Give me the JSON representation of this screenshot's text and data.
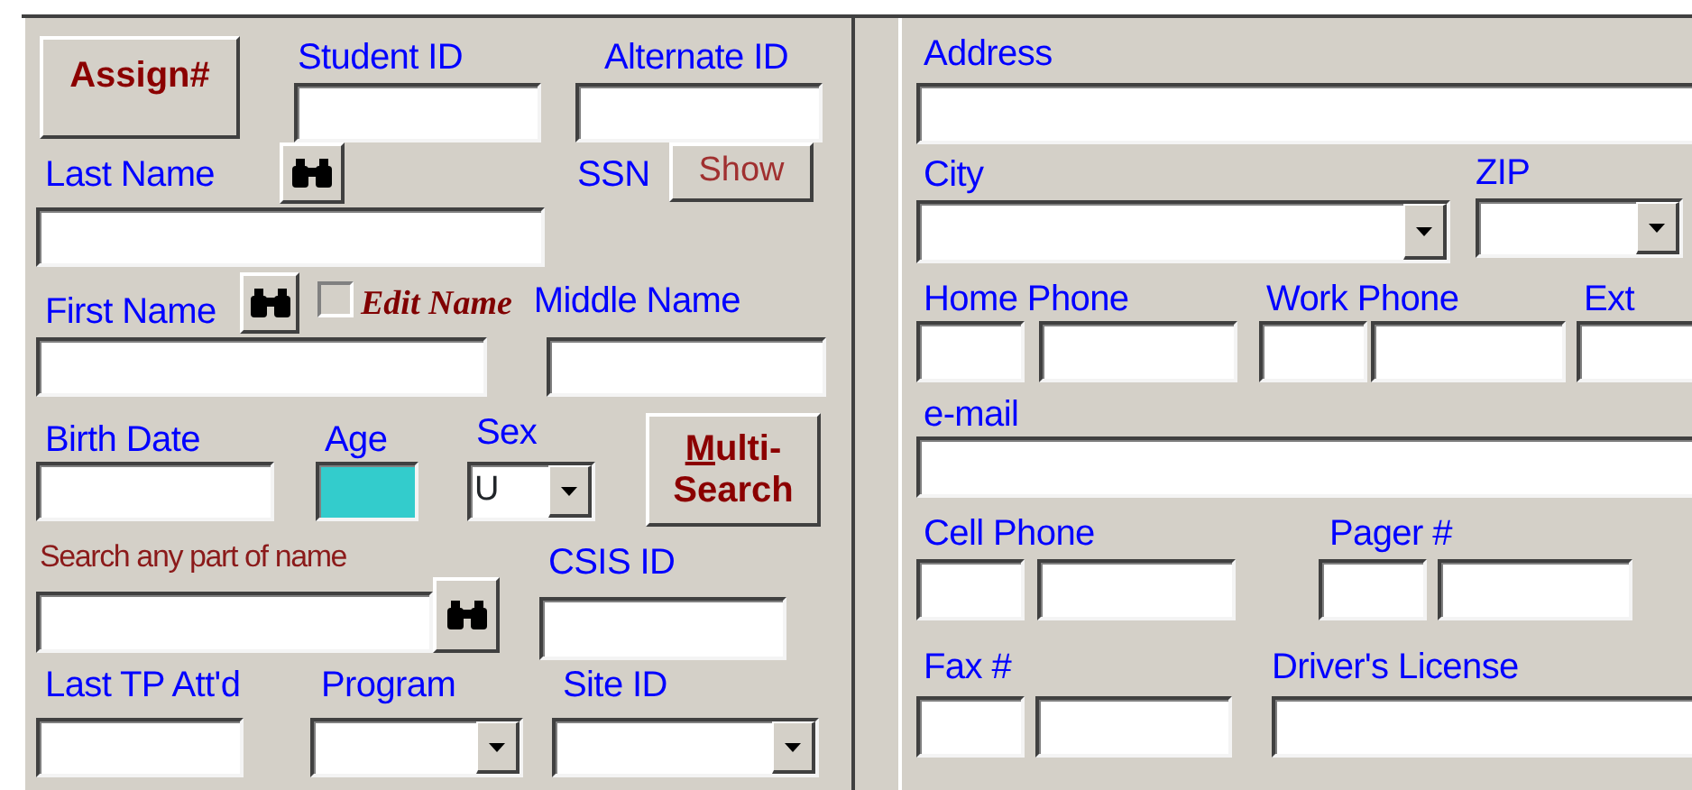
{
  "left_panel": {
    "assign_button": {
      "label": "Assign#"
    },
    "student_id": {
      "label": "Student ID"
    },
    "alternate_id": {
      "label": "Alternate ID"
    },
    "last_name": {
      "label": "Last Name"
    },
    "ssn": {
      "label": "SSN",
      "button": "Show"
    },
    "first_name": {
      "label": "First Name"
    },
    "edit_name": {
      "label": "Edit Name",
      "checked": false
    },
    "middle_name": {
      "label": "Middle Name"
    },
    "birth_date": {
      "label": "Birth Date"
    },
    "age": {
      "label": "Age"
    },
    "sex": {
      "label": "Sex",
      "value": "U"
    },
    "multi_search_button": {
      "lines": [
        "Multi-",
        "Search"
      ],
      "first_letter_underlined": true
    },
    "name_search": {
      "label": "Search any part of name"
    },
    "csis_id": {
      "label": "CSIS ID"
    },
    "last_tp_attended": {
      "label": "Last TP Att'd"
    },
    "program": {
      "label": "Program"
    },
    "site_id": {
      "label": "Site ID"
    }
  },
  "right_panel": {
    "address": {
      "label": "Address"
    },
    "city": {
      "label": "City"
    },
    "zip": {
      "label": "ZIP"
    },
    "home_phone": {
      "label": "Home Phone"
    },
    "work_phone": {
      "label": "Work Phone"
    },
    "ext": {
      "label": "Ext"
    },
    "email": {
      "label": "e-mail"
    },
    "cell_phone": {
      "label": "Cell Phone"
    },
    "pager": {
      "label": "Pager #"
    },
    "fax": {
      "label": "Fax #"
    },
    "drivers_license": {
      "label": "Driver's License"
    }
  }
}
